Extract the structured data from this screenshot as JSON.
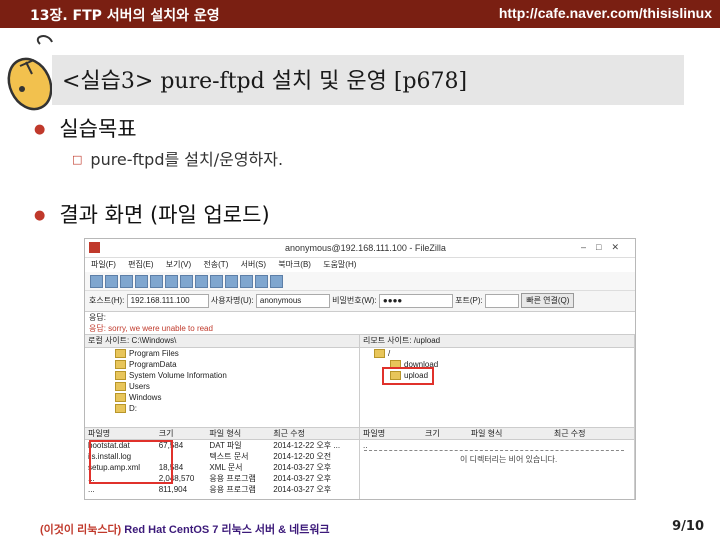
{
  "header": {
    "chapter": "13장. FTP 서버의 설치와 운영",
    "url": "http://cafe.naver.com/thisislinux"
  },
  "title": "<실습3> pure-ftpd 설치 및 운영 [p678]",
  "bullets": [
    {
      "text": "실습목표",
      "sub": "pure-ftpd를 설치/운영하자."
    },
    {
      "text": "결과 화면 (파일 업로드)"
    }
  ],
  "window": {
    "title": "anonymous@192.168.111.100 - FileZilla",
    "menu": [
      "파일(F)",
      "편집(E)",
      "보기(V)",
      "전송(T)",
      "서버(S)",
      "북마크(B)",
      "도움말(H)"
    ],
    "quickconnect": {
      "host_label": "호스트(H):",
      "host_value": "192.168.111.100",
      "user_label": "사용자명(U):",
      "user_value": "anonymous",
      "pass_label": "비밀번호(W):",
      "pass_value": "●●●●",
      "port_label": "포트(P):",
      "port_value": "",
      "connect_button": "빠른 연결(Q)"
    },
    "log": [
      "응답:",
      "응답:    sorry, we were unable to read"
    ],
    "local_tree": {
      "label": "로컬 사이트:",
      "path": "C:\\Windows\\",
      "items": [
        "Program Files",
        "ProgramData",
        "System Volume Information",
        "Users",
        "Windows",
        "D:"
      ]
    },
    "remote_tree": {
      "label": "리모트 사이트:",
      "path": "/upload",
      "items": [
        "/",
        "download",
        "upload"
      ]
    },
    "local_files": {
      "columns": [
        "파일명",
        "크기",
        "파일 형식",
        "최근 수정"
      ],
      "rows": [
        [
          "bootstat.dat",
          "67,584",
          "DAT 파일",
          "2014-12-22 오후 ..."
        ],
        [
          "iis.install.log",
          "",
          "텍스트 문서",
          "2014-12-20 오전"
        ],
        [
          "setup.amp.xml",
          "18,584",
          "XML 문서",
          "2014-03-27 오후"
        ],
        [
          "...",
          "2,048,570",
          "응용 프로그램",
          "2014-03-27 오후"
        ],
        [
          "...",
          "811,904",
          "응용 프로그램",
          "2014-03-27 오후"
        ]
      ]
    },
    "remote_files": {
      "columns": [
        "파일명",
        "크기",
        "파일 형식",
        "최근 수정"
      ],
      "rows": [
        [
          ".."
        ]
      ],
      "empty_text": "이 디렉터리는 비어 있습니다."
    }
  },
  "footer": {
    "book_kr": "(이것이 리눅스다)",
    "book_en": " Red Hat CentOS 7 리눅스 서버 & 네트워크"
  },
  "page": "9/10",
  "colors": {
    "topbar": "#7a1f12",
    "highlight": "#e0312b"
  }
}
